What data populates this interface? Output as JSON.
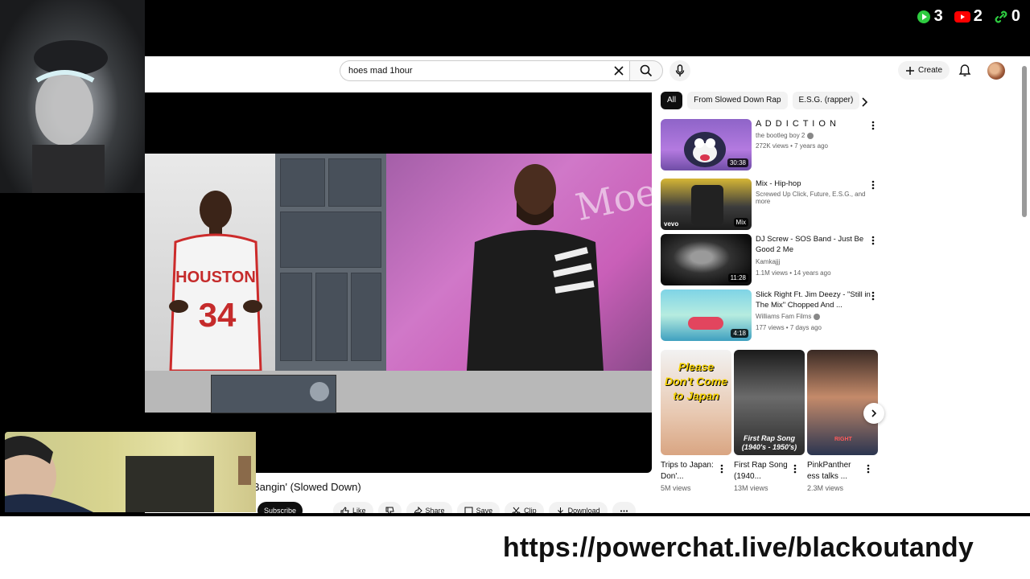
{
  "stream": {
    "counters": [
      {
        "icon": "play-icon",
        "value": "3",
        "color": "#2ecc40"
      },
      {
        "icon": "youtube-icon",
        "value": "2",
        "color": "#ff0000"
      },
      {
        "icon": "link-icon",
        "value": "0",
        "color": "#2ecc40"
      }
    ],
    "banner_url": "https://powerchat.live/blackoutandy"
  },
  "masthead": {
    "search_value": "hoes mad 1hour",
    "create_label": "Create"
  },
  "video": {
    "title": "Bangin' (Slowed Down)",
    "wall_text": "Moe",
    "actions": {
      "subscribe": "Subscribe",
      "like": "Like",
      "share": "Share",
      "save": "Save",
      "clip": "Clip",
      "download": "Download"
    }
  },
  "chips": [
    "All",
    "From Slowed Down Rap",
    "E.S.G. (rapper)"
  ],
  "recommendations": [
    {
      "title": "A D D I C T I O N",
      "channel": "the bootleg boy 2",
      "verified": true,
      "meta": "272K views • 7 years ago",
      "duration": "30:38"
    },
    {
      "title": "Mix - Hip-hop",
      "channel": "Screwed Up Click, Future, E.S.G., and more",
      "verified": false,
      "meta": "",
      "duration": "Mix",
      "badge": "vevo"
    },
    {
      "title": "DJ Screw - SOS Band - Just Be Good 2 Me",
      "channel": "Kamkajjj",
      "verified": false,
      "meta": "1.1M views • 14 years ago",
      "duration": "11:28"
    },
    {
      "title": "Slick Right Ft. Jim Deezy - \"Still in The Mix\" Chopped And ...",
      "channel": "Williams Fam Films",
      "verified": true,
      "meta": "177 views • 7 days ago",
      "duration": "4:18"
    }
  ],
  "shorts": [
    {
      "title": "Trips to Japan: Don'...",
      "views": "5M views",
      "overlay": "Please Don't Come to Japan"
    },
    {
      "title": "First Rap Song (1940...",
      "views": "13M views",
      "overlay": "First Rap Song (1940's - 1950's)"
    },
    {
      "title": "PinkPanther ess talks ...",
      "views": "2.3M views",
      "overlay": "RIGHT"
    }
  ]
}
